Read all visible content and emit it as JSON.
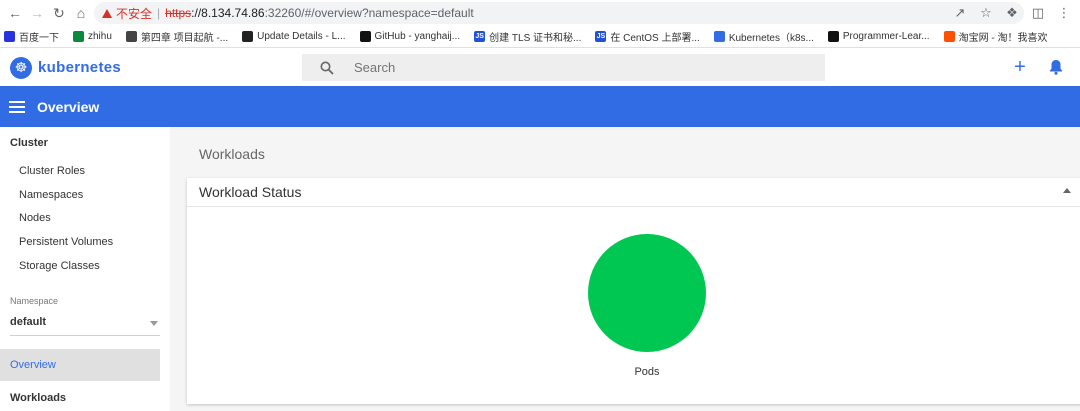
{
  "browser": {
    "security_label": "不安全",
    "url_scheme": "https",
    "url_host": "://8.134.74.86",
    "url_path": ":32260/#/overview?namespace=default"
  },
  "bookmarks": [
    {
      "label": "百度一下",
      "icon_color": "#2932e1"
    },
    {
      "label": "zhihu",
      "icon_color": "#0b8a3e"
    },
    {
      "label": "第四章 项目起航 -...",
      "icon_color": "#444444"
    },
    {
      "label": "Update Details - L...",
      "icon_color": "#222222"
    },
    {
      "label": "GitHub - yanghaij...",
      "icon_color": "#111111"
    },
    {
      "label": "创建 TLS 证书和秘...",
      "icon_color": "#2151d8"
    },
    {
      "label": "在 CentOS 上部署...",
      "icon_color": "#2151d8"
    },
    {
      "label": "Kubernetes（k8s...",
      "icon_color": "#326ce5"
    },
    {
      "label": "Programmer-Lear...",
      "icon_color": "#111111"
    },
    {
      "label": "淘宝网 - 淘！我喜欢",
      "icon_color": "#ff5000"
    }
  ],
  "app": {
    "brand": "kubernetes",
    "brand_color": "#326ce5",
    "search_placeholder": "Search",
    "toolbar_title": "Overview"
  },
  "sidebar": {
    "cluster_heading": "Cluster",
    "cluster_items": [
      "Cluster Roles",
      "Namespaces",
      "Nodes",
      "Persistent Volumes",
      "Storage Classes"
    ],
    "namespace_label": "Namespace",
    "namespace_value": "default",
    "active_item": "Overview",
    "workloads_heading": "Workloads"
  },
  "main": {
    "section_title": "Workloads",
    "card_title": "Workload Status",
    "pie_label": "Pods",
    "pie_color": "#00c752"
  }
}
